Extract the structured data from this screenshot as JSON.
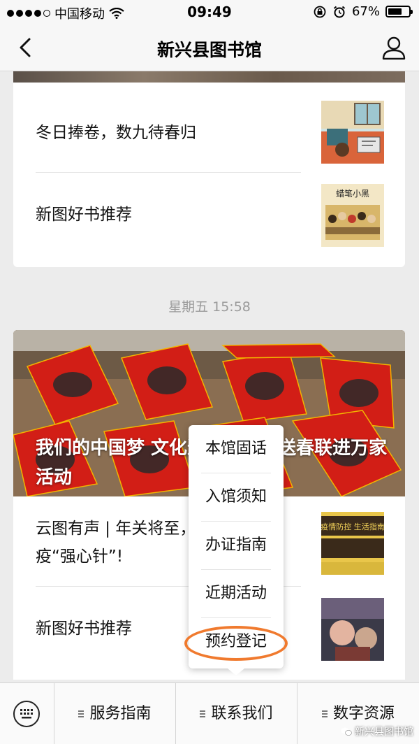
{
  "status_bar": {
    "carrier": "中国移动",
    "time": "09:49",
    "battery": "67%",
    "battery_level": 0.67
  },
  "nav": {
    "title": "新兴县图书馆"
  },
  "articles_top": [
    {
      "title": "冬日捧卷，数九待春归",
      "thumb": "cartoon-illustration"
    },
    {
      "title": "新图好书推荐",
      "thumb": "book-cover",
      "thumb_text": "蜡笔小黑"
    }
  ],
  "date_label": "星期五 15:58",
  "main_article": {
    "hero_title": "我们的中国梦 文化进万家——送春联进万家活动"
  },
  "articles_bottom": [
    {
      "title": "云图有声 | 年关将至，送您一剂防疫“强心针”!",
      "thumb": "poster",
      "thumb_text": "疫情防控 生活指南"
    },
    {
      "title": "新图好书推荐",
      "thumb": "book-cover-dark"
    }
  ],
  "popup_menu": {
    "items": [
      "本馆固话",
      "入馆须知",
      "办证指南",
      "近期活动",
      "预约登记"
    ],
    "highlighted": "预约登记"
  },
  "menu_bar": {
    "items": [
      "服务指南",
      "联系我们",
      "数字资源"
    ]
  },
  "watermark": "新兴县图书馆",
  "colors": {
    "highlight_ring": "#f07a2e",
    "couplet_red": "#d21e16"
  }
}
